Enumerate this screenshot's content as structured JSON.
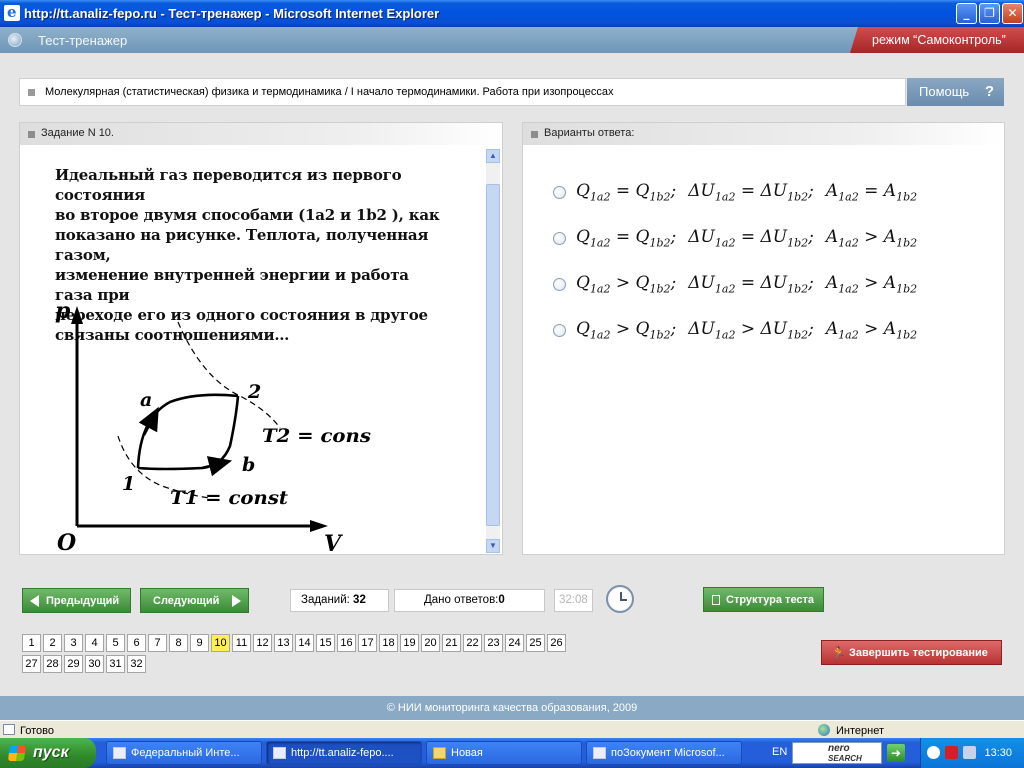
{
  "browser": {
    "title": "http://tt.analiz-fepo.ru - Тест-тренажер - Microsoft Internet Explorer",
    "status_left": "Готово",
    "status_right": "Интернет"
  },
  "app": {
    "title": "Тест-тренажер",
    "mode": "режим “Самоконтроль”"
  },
  "breadcrumb": {
    "text": "Молекулярная (статистическая) физика и термодинамика / I начало термодинамики. Работа при изопроцессах",
    "help_label": "Помощь",
    "help_icon": "?"
  },
  "question": {
    "header": "Задание N 10.",
    "lines": [
      "Идеальный газ переводится из первого состояния",
      "во второе двумя способами (1a2  и 1b2 ), как",
      "показано на рисунке. Теплота, полученная газом,",
      "изменение внутренней энергии и работа газа при",
      "переходе его из одного состояния в другое",
      "связаны соотношениями…"
    ],
    "diagram": {
      "y_axis_label": "p",
      "x_axis_label": "V",
      "origin_label": "O",
      "point_1": "1",
      "point_2": "2",
      "path_a": "a",
      "path_b": "b",
      "isotherm_1": "T1 = const",
      "isotherm_2": "T2 = const"
    }
  },
  "answers": {
    "header": "Варианты ответа:",
    "options": [
      {
        "q_rel": "=",
        "u_rel": "=",
        "a_rel": "="
      },
      {
        "q_rel": "=",
        "u_rel": "=",
        "a_rel": ">"
      },
      {
        "q_rel": ">",
        "u_rel": "=",
        "a_rel": ">"
      },
      {
        "q_rel": ">",
        "u_rel": ">",
        "a_rel": ">"
      }
    ]
  },
  "controls": {
    "prev_label": "Предыдущий",
    "next_label": "Следующий",
    "tasks_label": "Заданий:",
    "tasks_value": "32",
    "answered_label": "Дано ответов:",
    "answered_value": "0",
    "timer": "32:08",
    "structure_label": "Структура теста",
    "finish_label": "Завершить тестирование",
    "current_question": 10,
    "question_numbers": [
      "1",
      "2",
      "3",
      "4",
      "5",
      "6",
      "7",
      "8",
      "9",
      "10",
      "11",
      "12",
      "13",
      "14",
      "15",
      "16",
      "17",
      "18",
      "19",
      "20",
      "21",
      "22",
      "23",
      "24",
      "25",
      "26",
      "27",
      "28",
      "29",
      "30",
      "31",
      "32"
    ]
  },
  "footer": "© НИИ мониторинга качества образования, 2009",
  "taskbar": {
    "start_label": "пуск",
    "tasks": [
      {
        "label": "Федеральный Инте...",
        "icon": "ie-icon"
      },
      {
        "label": "http://tt.analiz-fepo....",
        "icon": "ie-icon"
      },
      {
        "label": "Новая",
        "icon": "folder-icon"
      },
      {
        "label": "поЗокумент Microsof...",
        "icon": "word-icon"
      }
    ],
    "lang": "EN",
    "search_brand_1": "nero",
    "search_brand_2": "SEARCH",
    "clock": "13:30"
  },
  "colors": {
    "mode_badge": "#b83232",
    "nav_green": "#3c8b37",
    "finish_red": "#b93232",
    "current_number": "#ffef4f",
    "app_header": "#7fa3c1"
  }
}
